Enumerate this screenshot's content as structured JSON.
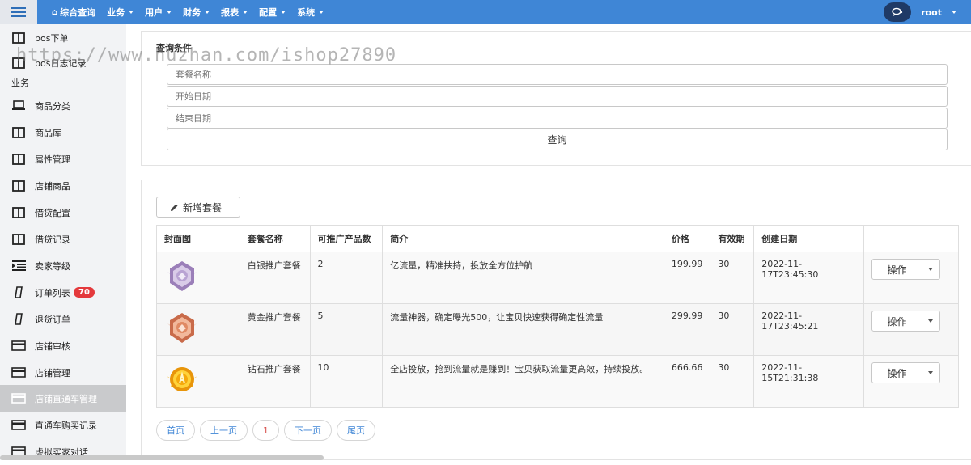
{
  "topbar": {
    "nav": [
      {
        "label": "综合查询",
        "icon": "home-icon",
        "caret": false
      },
      {
        "label": "业务",
        "caret": true
      },
      {
        "label": "用户",
        "caret": true
      },
      {
        "label": "财务",
        "caret": true
      },
      {
        "label": "报表",
        "caret": true
      },
      {
        "label": "配置",
        "caret": true
      },
      {
        "label": "系统",
        "caret": true
      }
    ],
    "user": "root",
    "accent": "#3f86d6"
  },
  "sidebar": {
    "section_label": "业务",
    "items": [
      {
        "label": "pos下单",
        "icon": "columns-icon"
      },
      {
        "label": "pos日志记录",
        "icon": "columns-icon"
      },
      {
        "label": "商品分类",
        "icon": "laptop-icon"
      },
      {
        "label": "商品库",
        "icon": "columns-icon"
      },
      {
        "label": "属性管理",
        "icon": "columns-icon"
      },
      {
        "label": "店铺商品",
        "icon": "columns-icon"
      },
      {
        "label": "借贷配置",
        "icon": "columns-icon"
      },
      {
        "label": "借贷记录",
        "icon": "columns-icon"
      },
      {
        "label": "卖家等级",
        "icon": "indent-icon"
      },
      {
        "label": "订单列表",
        "icon": "mobile-icon",
        "badge": "70"
      },
      {
        "label": "退货订单",
        "icon": "mobile-icon"
      },
      {
        "label": "店铺审核",
        "icon": "card-icon"
      },
      {
        "label": "店铺管理",
        "icon": "card-icon"
      },
      {
        "label": "店铺直通车管理",
        "icon": "card-icon",
        "active": true
      },
      {
        "label": "直通车购买记录",
        "icon": "card-icon"
      },
      {
        "label": "虚拟买家对话",
        "icon": "card-icon"
      }
    ]
  },
  "watermark": "https://www.huzhan.com/ishop27890",
  "query": {
    "title": "查询条件",
    "package_name_placeholder": "套餐名称",
    "start_date_placeholder": "开始日期",
    "end_date_placeholder": "结束日期",
    "submit_label": "查询"
  },
  "list": {
    "add_label": "新增套餐",
    "columns": [
      "封面图",
      "套餐名称",
      "可推广产品数",
      "简介",
      "价格",
      "有效期",
      "创建日期",
      ""
    ],
    "rows": [
      {
        "name": "白银推广套餐",
        "count": "2",
        "intro": "亿流量，精准扶持，投放全方位护航",
        "price": "199.99",
        "valid": "30",
        "created": "2022-11-17T23:45:30",
        "medal": "silver-medal-icon"
      },
      {
        "name": "黄金推广套餐",
        "count": "5",
        "intro": "流量神器，确定曝光500，让宝贝快速获得确定性流量",
        "price": "299.99",
        "valid": "30",
        "created": "2022-11-17T23:45:21",
        "medal": "bronze-medal-icon"
      },
      {
        "name": "钻石推广套餐",
        "count": "10",
        "intro": "全店投放，抢到流量就是赚到！宝贝获取流量更高效，持续投放。",
        "price": "666.66",
        "valid": "30",
        "created": "2022-11-15T21:31:38",
        "medal": "gold-medal-icon"
      }
    ],
    "ops_label": "操作"
  },
  "pager": {
    "first": "首页",
    "prev": "上一页",
    "current": "1",
    "next": "下一页",
    "last": "尾页"
  }
}
